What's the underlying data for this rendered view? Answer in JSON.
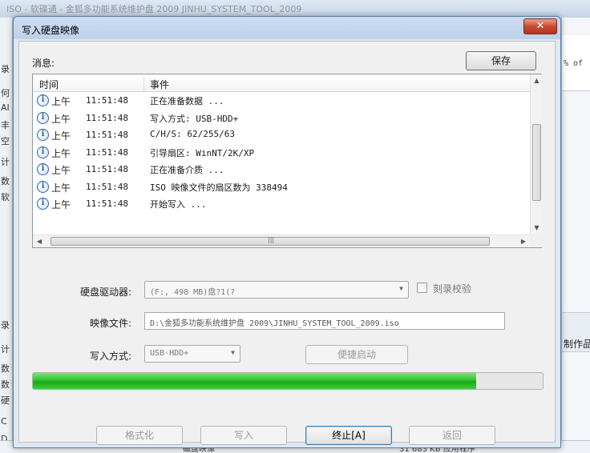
{
  "background": {
    "window_title": "ISO - 软碟通 - 金狐多功能系统维护盘 2009 JINHU_SYSTEM_TOOL_2009",
    "right_top_text": "% of",
    "right_mid_text": "制作品",
    "left_chars": [
      "录",
      "何",
      "AI",
      "丰",
      "空",
      "计",
      "数",
      "软",
      "录",
      "计",
      "数",
      "数",
      "硬",
      "C",
      "D"
    ],
    "bottom_left_text": "磁盘映像",
    "bottom_right_text": "31 683 KB 应用程序"
  },
  "dialog": {
    "title": "写入硬盘映像",
    "close_label": "✕",
    "messages_label": "消息:",
    "save_label": "保存",
    "columns": {
      "time": "时间",
      "event": "事件"
    },
    "log": [
      {
        "ampm": "上午",
        "time": "11:51:48",
        "event": "正在准备数据 ..."
      },
      {
        "ampm": "上午",
        "time": "11:51:48",
        "event": "写入方式: USB-HDD+"
      },
      {
        "ampm": "上午",
        "time": "11:51:48",
        "event": "C/H/S: 62/255/63"
      },
      {
        "ampm": "上午",
        "time": "11:51:48",
        "event": "引导扇区: WinNT/2K/XP"
      },
      {
        "ampm": "上午",
        "time": "11:51:48",
        "event": "正在准备介质 ..."
      },
      {
        "ampm": "上午",
        "time": "11:51:48",
        "event": "ISO 映像文件的扇区数为 338494"
      },
      {
        "ampm": "上午",
        "time": "11:51:48",
        "event": "开始写入 ..."
      }
    ],
    "form": {
      "drive_label": "硬盘驱动器:",
      "drive_value": "(F:, 498 MB)盘?1(?",
      "verify_label": "刻录校验",
      "image_label": "映像文件:",
      "image_value": "D:\\金狐多功能系统维护盘 2009\\JINHU_SYSTEM_TOOL_2009.iso",
      "mode_label": "写入方式:",
      "mode_value": "USB-HDD+",
      "quick_boot_label": "便捷启动"
    },
    "progress": 0.87,
    "buttons": {
      "format": "格式化",
      "write": "写入",
      "stop": "终止[A]",
      "back": "返回"
    }
  }
}
